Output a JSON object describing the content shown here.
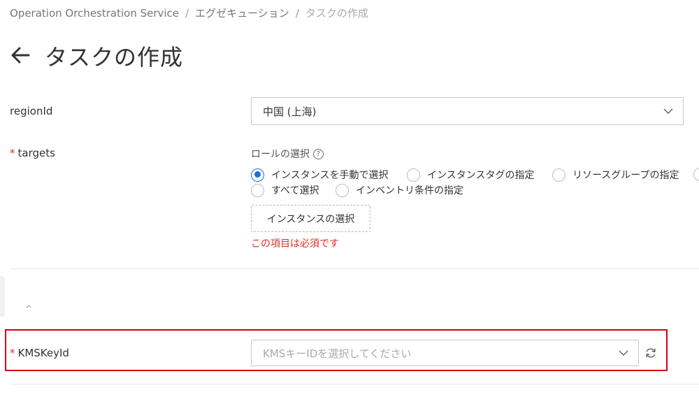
{
  "breadcrumb": {
    "items": [
      "Operation Orchestration Service",
      "エグゼキューション"
    ],
    "separator": "/",
    "current": "タスクの作成"
  },
  "header": {
    "title": "タスクの作成"
  },
  "form": {
    "region": {
      "label": "regionId",
      "value": "中国 (上海)"
    },
    "targets": {
      "required_mark": "*",
      "label": "targets",
      "role_label": "ロールの選択",
      "help_glyph": "?",
      "options": [
        {
          "label": "インスタンスを手動で選択",
          "checked": true
        },
        {
          "label": "インスタンスタグの指定",
          "checked": false
        },
        {
          "label": "リソースグループの指定",
          "checked": false
        },
        {
          "label": "すべて選択",
          "checked": false
        },
        {
          "label": "インベントリ条件の指定",
          "checked": false
        }
      ],
      "select_button": "インスタンスの選択",
      "error": "この項目は必須です"
    },
    "kms": {
      "required_mark": "*",
      "label": "KMSKeyId",
      "placeholder": "KMSキーIDを選択してください"
    }
  },
  "colors": {
    "accent": "#1a6fdc",
    "error": "#d93026",
    "highlight_border": "#d7000f"
  }
}
